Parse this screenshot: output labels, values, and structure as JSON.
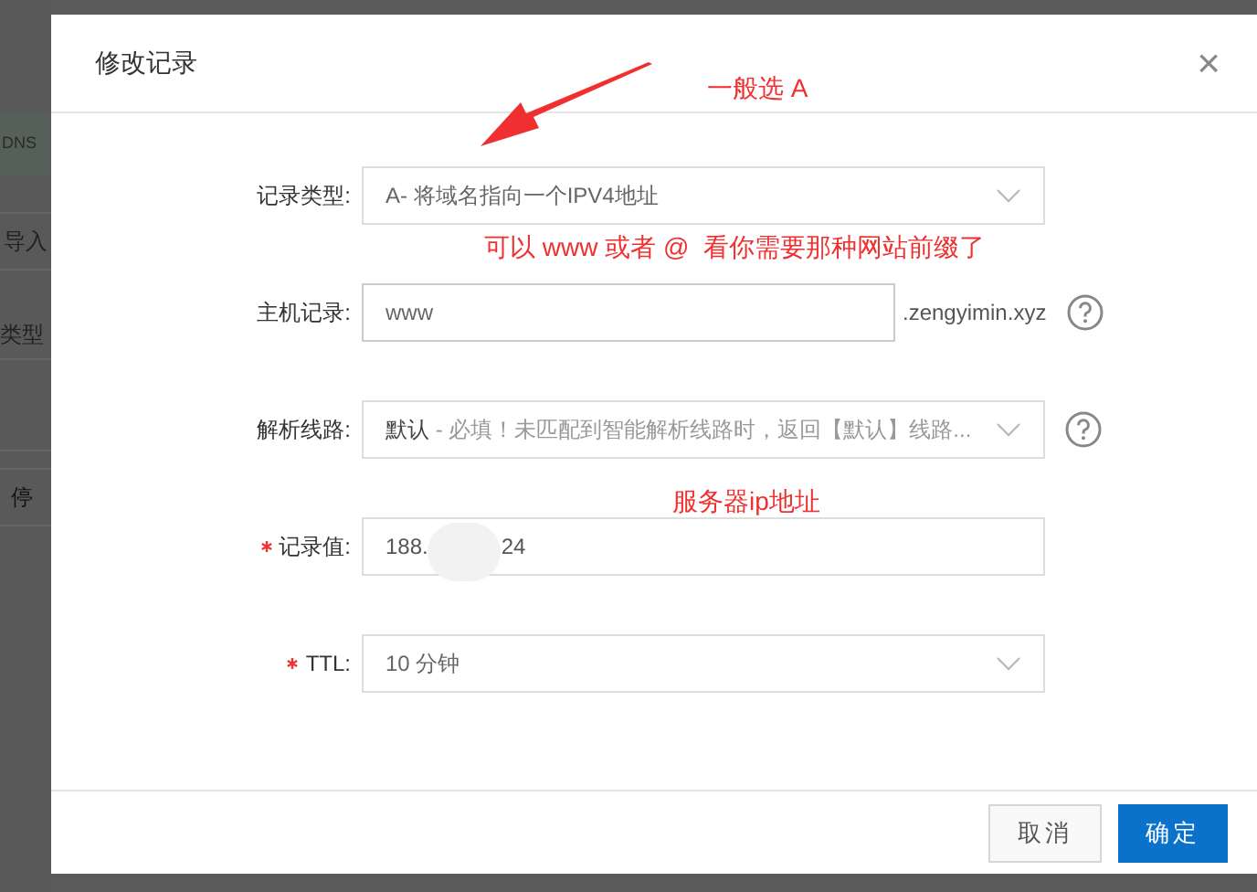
{
  "background_page": {
    "subtitle": "DNS",
    "import_button": "导入",
    "column_header": "类型",
    "pause_button": "停"
  },
  "dialog": {
    "title": "修改记录",
    "close": "×",
    "fields": [
      {
        "kind": "select",
        "label": "记录类型:",
        "required": false,
        "value": "A- 将域名指向一个IPV4地址",
        "help": false
      },
      {
        "kind": "input",
        "label": "主机记录:",
        "required": false,
        "value": "www",
        "suffix": ".zengyimin.xyz",
        "help": true
      },
      {
        "kind": "select",
        "label": "解析线路:",
        "required": false,
        "value": "默认",
        "hint": " - 必填！未匹配到智能解析线路时，返回【默认】线路...",
        "help": true
      },
      {
        "kind": "redacted",
        "label": "记录值:",
        "required": true,
        "value_start": "188.",
        "value_end": "24",
        "help": false
      },
      {
        "kind": "select",
        "label": "TTL:",
        "required": true,
        "value": "10 分钟",
        "help": false
      }
    ],
    "buttons": [
      {
        "label": "取消",
        "primary": false
      },
      {
        "label": "确定",
        "primary": true
      }
    ]
  },
  "annotations": [
    {
      "kind": "text",
      "text": "一般选 A"
    },
    {
      "kind": "text",
      "text": "可以 www 或者 @  看你需要那种网站前缀了"
    },
    {
      "kind": "text",
      "text": "服务器ip地址"
    },
    {
      "kind": "arrow"
    }
  ]
}
